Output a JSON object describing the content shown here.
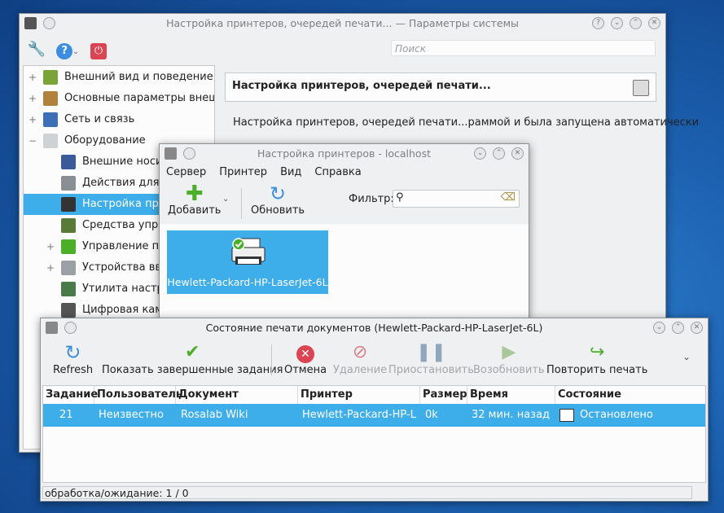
{
  "settings_window": {
    "title": "Настройка принтеров, очередей печати... — Параметры системы",
    "search_placeholder": "Поиск",
    "tree": [
      {
        "label": "Внешний вид и поведение ср",
        "expander": "+",
        "level": 0
      },
      {
        "label": "Основные параметры внешн",
        "expander": "+",
        "level": 0
      },
      {
        "label": "Сеть и связь",
        "expander": "+",
        "level": 0
      },
      {
        "label": "Оборудование",
        "expander": "−",
        "level": 0
      },
      {
        "label": "Внешние носит",
        "expander": "",
        "level": 1
      },
      {
        "label": "Действия для ус",
        "expander": "",
        "level": 1
      },
      {
        "label": "Настройка прин",
        "expander": "",
        "level": 1
      },
      {
        "label": "Средства управ",
        "expander": "",
        "level": 1
      },
      {
        "label": "Управление пит",
        "expander": "+",
        "level": 1
      },
      {
        "label": "Устройства ввод",
        "expander": "+",
        "level": 1
      },
      {
        "label": "Утилита настро",
        "expander": "",
        "level": 1
      },
      {
        "label": "Цифровая каме",
        "expander": "",
        "level": 1
      }
    ],
    "panel_title": "Настройка принтеров, очередей печати...",
    "description": "Настройка принтеров, очередей печати...раммой и была запущена автоматически"
  },
  "printers_window": {
    "title": "Настройка принтеров - localhost",
    "menu": [
      "Сервер",
      "Принтер",
      "Вид",
      "Справка"
    ],
    "add_label": "Добавить",
    "refresh_label": "Обновить",
    "filter_label": "Фильтр:",
    "printer_name": "Hewlett-Packard-HP-LaserJet-6L"
  },
  "jobs_window": {
    "title": "Состояние печати документов (Hewlett-Packard-HP-LaserJet-6L)",
    "toolbar": {
      "refresh": "Refresh",
      "show_completed": "Показать завершенные задания",
      "cancel": "Отмена",
      "delete": "Удаление",
      "pause": "Приостановить",
      "resume": "Возобновить",
      "reprint": "Повторить печать"
    },
    "columns": [
      "Задание",
      "Пользователь",
      "Документ",
      "Принтер",
      "Размер",
      "Время отсылки",
      "Состояние"
    ],
    "rows": [
      {
        "job": "21",
        "user": "Неизвестно",
        "document": "Rosalab Wiki",
        "printer": "Hewlett-Packard-HP-L...",
        "size": "0k",
        "time": "32 мин. назад",
        "state": "Остановлено"
      }
    ],
    "status": "обработка/ожидание:  1 / 0"
  },
  "colors": {
    "selection": "#3daee9",
    "window_bg": "#eff0f1"
  }
}
